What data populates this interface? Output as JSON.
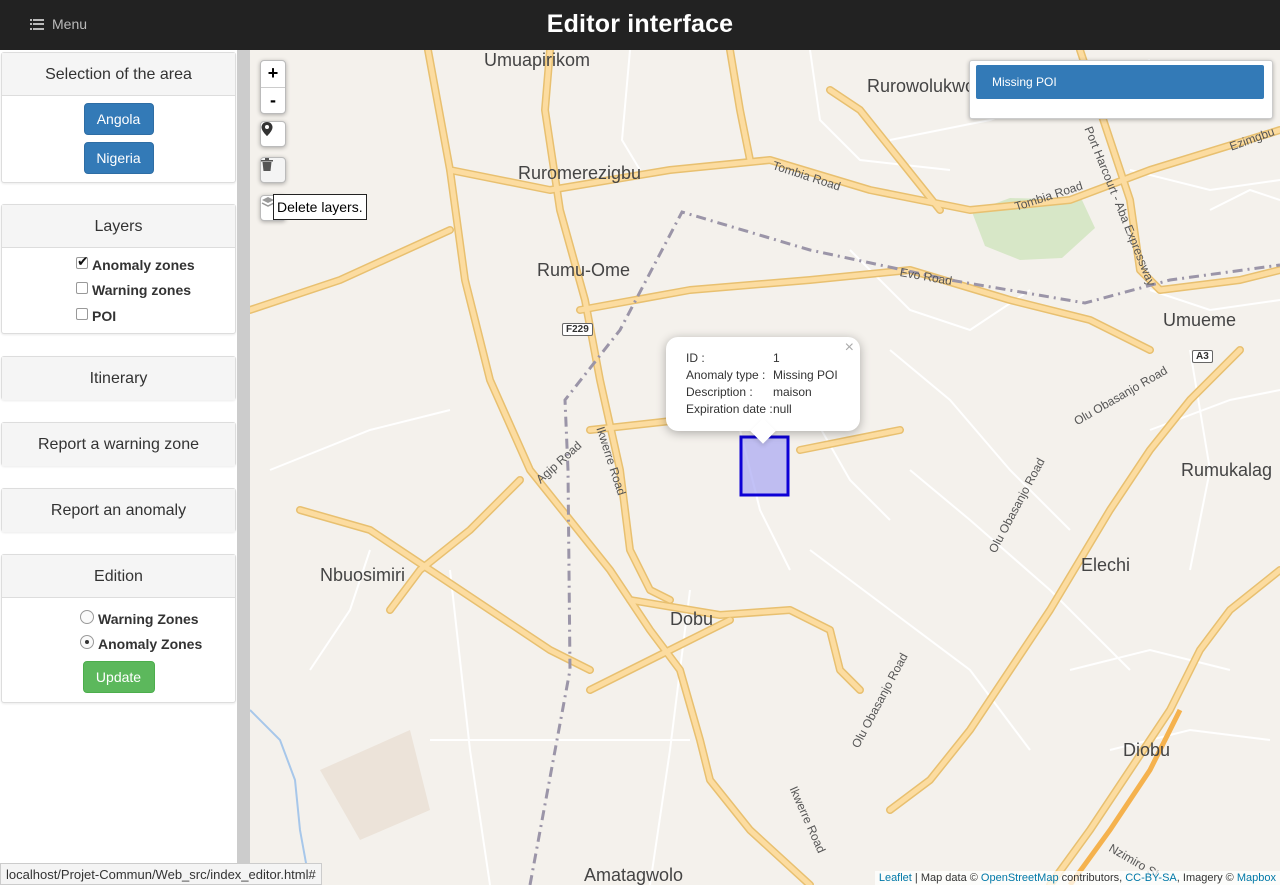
{
  "header": {
    "menu_label": "Menu",
    "title": "Editor interface"
  },
  "sidebar": {
    "area": {
      "heading": "Selection of the area",
      "buttons": [
        "Angola",
        "Nigeria"
      ]
    },
    "layers": {
      "heading": "Layers",
      "items": [
        {
          "label": "Anomaly zones",
          "checked": true
        },
        {
          "label": "Warning zones",
          "checked": false
        },
        {
          "label": "POI",
          "checked": false
        }
      ]
    },
    "itinerary_label": "Itinerary",
    "report_warning_label": "Report a warning zone",
    "report_anomaly_label": "Report an anomaly",
    "edition": {
      "heading": "Edition",
      "options": [
        {
          "label": "Warning Zones",
          "selected": false
        },
        {
          "label": "Anomaly Zones",
          "selected": true
        }
      ],
      "update_label": "Update"
    }
  },
  "map": {
    "controls": {
      "zoom_in": "+",
      "zoom_out": "-",
      "tooltip": "Delete layers."
    },
    "places": [
      "Umuapirikom",
      "Rurowolukwo",
      "Ruromerezigbu",
      "Rumu-Ome",
      "Umueme",
      "Rumukalag",
      "Nbuosimiri",
      "Dobu",
      "Elechi",
      "Diobu",
      "Amatagwolo"
    ],
    "road_labels": [
      "Tombia Road",
      "Tombia Road",
      "Evo Road",
      "Port Harcourt - Aba Expressway",
      "Ezimgbu",
      "Olu Obasanjo Road",
      "Olu Obasanjo Road",
      "Olu Obasanjo Road",
      "Agip Road",
      "Ikwerre Road",
      "Ikwerre Road",
      "Nzimiro St"
    ],
    "shields": [
      "F229",
      "A3"
    ],
    "popup": {
      "rows": [
        {
          "key": "ID :",
          "value": "1"
        },
        {
          "key": "Anomaly type :",
          "value": "Missing POI"
        },
        {
          "key": "Description :",
          "value": "maison"
        },
        {
          "key": "Expiration date :",
          "value": "null"
        }
      ],
      "close": "×"
    },
    "search_result": "Missing POI",
    "attribution": {
      "leaflet": "Leaflet",
      "sep1": " | Map data © ",
      "osm": "OpenStreetMap",
      "contributors": " contributors, ",
      "license": "CC-BY-SA",
      "imagery": ", Imagery © ",
      "mapbox": "Mapbox"
    },
    "colors": {
      "major_road": "#f7d488",
      "minor_road": "#ffffff",
      "boundary": "#9b95a8",
      "zone_fill": "#a8a6f4",
      "zone_stroke": "#0d00d6",
      "park": "#d7e7c7"
    }
  },
  "statusbar": {
    "url": "localhost/Projet-Commun/Web_src/index_editor.html#"
  }
}
